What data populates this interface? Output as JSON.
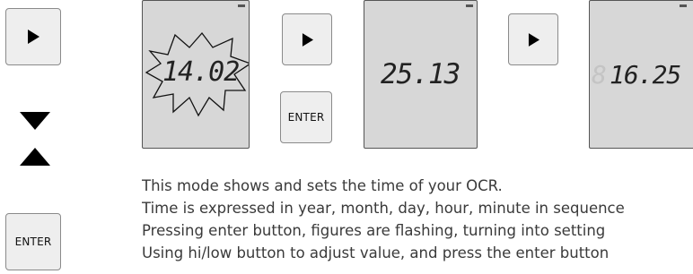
{
  "side_controls": {
    "right_icon": "play-triangle-right",
    "down_icon": "triangle-down",
    "up_icon": "triangle-up",
    "enter_label": "ENTER"
  },
  "sequence": {
    "next_icon": "play-triangle-right",
    "enter_label": "ENTER",
    "screens": [
      {
        "digits": "14.02",
        "highlight": "burst"
      },
      {
        "digits": "25.13"
      },
      {
        "leading_ghost": "8",
        "digits": "16.25"
      }
    ]
  },
  "description": {
    "lines": [
      "This mode shows and sets the time of your OCR.",
      "Time is expressed in year, month, day, hour, minute in sequence",
      "Pressing enter button, figures are flashing, turning into setting",
      "Using hi/low button to adjust value, and press the enter button"
    ]
  },
  "colors": {
    "lcd_background": "#d7d7d7",
    "button_background": "#eeeeee",
    "text": "#3a3a3a"
  }
}
